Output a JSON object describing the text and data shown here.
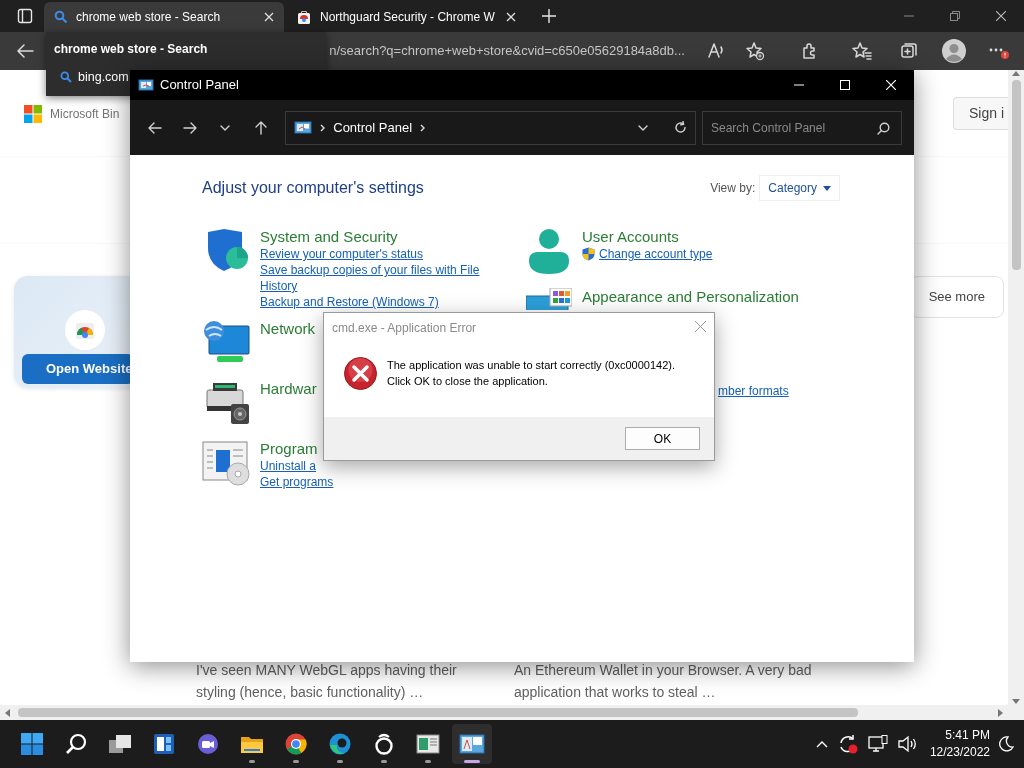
{
  "browser": {
    "tabs": [
      {
        "title": "chrome web store - Search",
        "selected": true,
        "kind": "search"
      },
      {
        "title": "Northguard Security - Chrome W",
        "selected": false,
        "kind": "store"
      }
    ],
    "hover_card": {
      "title": "chrome web store - Search",
      "site": "bing.com"
    },
    "address": "n/search?q=chrome+web+store&cvid=c650e05629184a8db...",
    "page": {
      "logo_text": "Microsoft Bin",
      "sign_in": "Sign i",
      "card_button": "Open Website",
      "see_more": "See more",
      "snippets": [
        "I've seen MANY WebGL apps having their styling (hence, basic functionality) …",
        "An Ethereum Wallet in your Browser. A very bad application that works to steal …"
      ]
    }
  },
  "control_panel": {
    "title": "Control Panel",
    "breadcrumb": "Control Panel",
    "search": {
      "placeholder": "Search Control Panel"
    },
    "heading": "Adjust your computer's settings",
    "view_by_label": "View by:",
    "view_by": "Category",
    "left_column": [
      {
        "kind": "shield",
        "title": "System and Security",
        "links": [
          "Review your computer's status",
          "Save backup copies of your files with File History",
          "Backup and Restore (Windows 7)"
        ]
      },
      {
        "kind": "network",
        "title": "Network"
      },
      {
        "kind": "printer",
        "title": "Hardwar"
      },
      {
        "kind": "programs",
        "title": "Program",
        "links": [
          "Uninstall a",
          "Get programs"
        ]
      }
    ],
    "right_column": [
      {
        "kind": "user",
        "title": "User Accounts",
        "links": [
          "Change account type"
        ]
      },
      {
        "kind": "appearance",
        "title": "Appearance and Personalization"
      },
      {
        "kind": "covered",
        "links": [
          "mber formats"
        ]
      }
    ]
  },
  "dialog": {
    "title": "cmd.exe - Application Error",
    "message_lines": [
      "The application was unable to start correctly (0xc0000142).",
      "Click OK to close the application."
    ],
    "button": "OK"
  },
  "taskbar": {
    "apps": [
      {
        "kind": "start",
        "running": false,
        "selected": false
      },
      {
        "kind": "search",
        "running": false,
        "selected": false
      },
      {
        "kind": "taskview",
        "running": false,
        "selected": false
      },
      {
        "kind": "widgets",
        "running": false,
        "selected": false
      },
      {
        "kind": "chat",
        "running": false,
        "selected": false
      },
      {
        "kind": "explorer",
        "running": true,
        "selected": false
      },
      {
        "kind": "chrome",
        "running": true,
        "selected": false
      },
      {
        "kind": "edge",
        "running": true,
        "selected": false
      },
      {
        "kind": "ring",
        "running": true,
        "selected": false
      },
      {
        "kind": "app",
        "running": true,
        "selected": false
      },
      {
        "kind": "controlpanel",
        "running": true,
        "selected": true
      }
    ],
    "time": "5:41 PM",
    "date": "12/23/2022"
  }
}
